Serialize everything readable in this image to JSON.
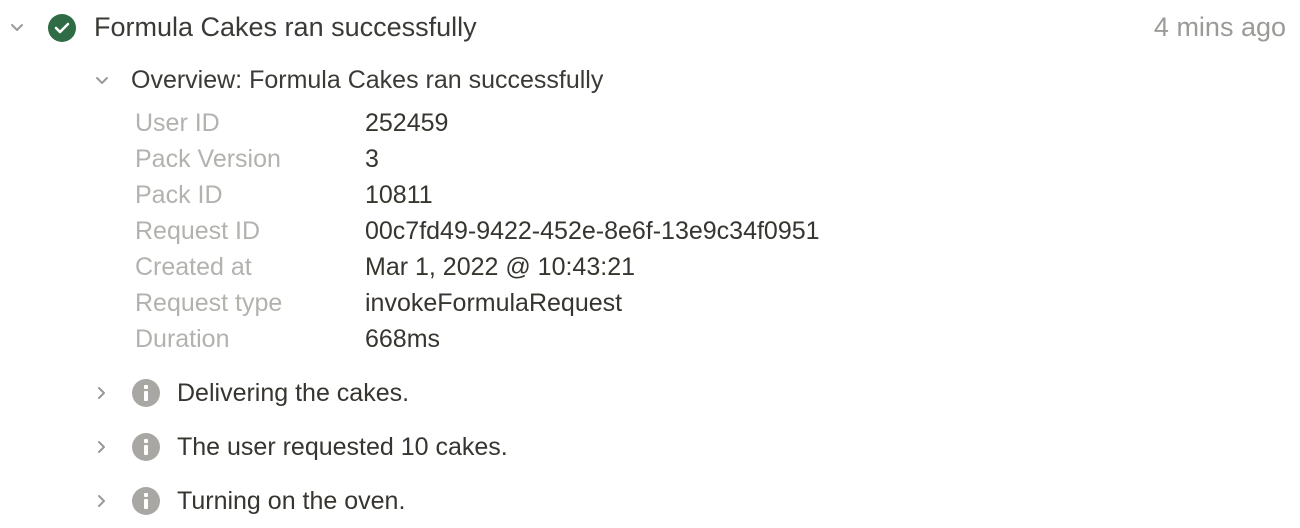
{
  "entry": {
    "status_icon": "check-circle-icon",
    "status_color": "#2f6b45",
    "title": "Formula Cakes ran successfully",
    "time": "4 mins ago"
  },
  "overview": {
    "title": "Overview: Formula Cakes ran successfully",
    "properties": [
      {
        "label": "User ID",
        "value": "252459"
      },
      {
        "label": "Pack Version",
        "value": "3"
      },
      {
        "label": "Pack ID",
        "value": "10811"
      },
      {
        "label": "Request ID",
        "value": "00c7fd49-9422-452e-8e6f-13e9c34f0951"
      },
      {
        "label": "Created at",
        "value": "Mar 1, 2022 @ 10:43:21"
      },
      {
        "label": "Request type",
        "value": "invokeFormulaRequest"
      },
      {
        "label": "Duration",
        "value": "668ms"
      }
    ]
  },
  "sub_items": [
    {
      "label": "Delivering the cakes.",
      "icon": "info-icon",
      "expanded": false
    },
    {
      "label": "The user requested 10 cakes.",
      "icon": "info-icon",
      "expanded": false
    },
    {
      "label": "Turning on the oven.",
      "icon": "info-icon",
      "expanded": false
    }
  ]
}
